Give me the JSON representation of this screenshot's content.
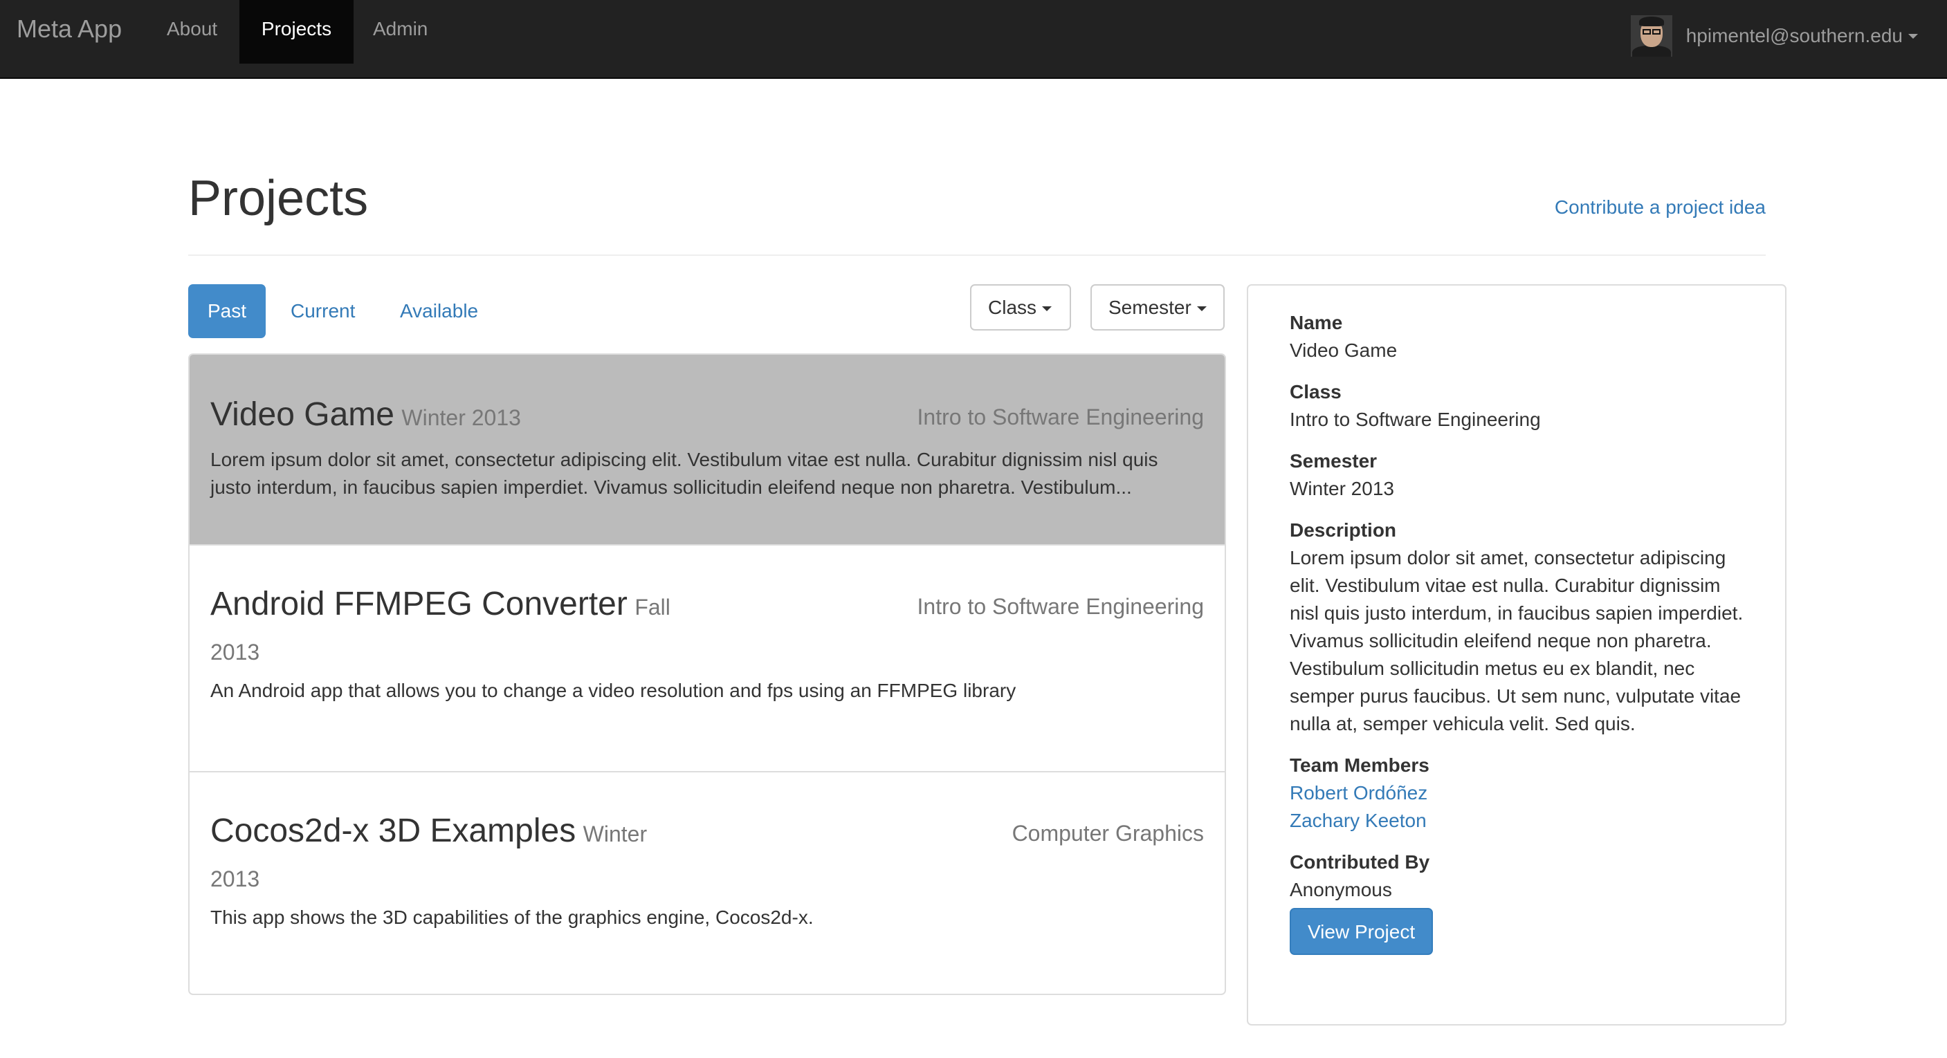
{
  "navbar": {
    "brand": "Meta App",
    "links": [
      "About",
      "Projects",
      "Admin"
    ],
    "active": "Projects",
    "user_email": "hpimentel@southern.edu"
  },
  "page": {
    "title": "Projects",
    "contribute_link": "Contribute a project idea"
  },
  "tabs": {
    "items": [
      "Past",
      "Current",
      "Available"
    ],
    "active": "Past"
  },
  "filters": {
    "class_label": "Class",
    "semester_label": "Semester"
  },
  "projects": [
    {
      "name": "Video Game",
      "semester": "Winter 2013",
      "class": "Intro to Software Engineering",
      "description": "Lorem ipsum dolor sit amet, consectetur adipiscing elit. Vestibulum vitae est nulla. Curabitur dignissim nisl quis justo interdum, in faucibus sapien imperdiet. Vivamus sollicitudin eleifend neque non pharetra. Vestibulum..."
    },
    {
      "name": "Android FFMPEG Converter",
      "semester_part1": "Fall",
      "semester_part2": "2013",
      "class": "Intro to Software Engineering",
      "description": "An Android app that allows you to change a video resolution and fps using an FFMPEG library"
    },
    {
      "name": "Cocos2d-x 3D Examples",
      "semester_part1": "Winter",
      "semester_part2": "2013",
      "class": "Computer Graphics",
      "description": "This app shows the 3D capabilities of the graphics engine, Cocos2d-x."
    }
  ],
  "detail": {
    "name_label": "Name",
    "name": "Video Game",
    "class_label": "Class",
    "class": "Intro to Software Engineering",
    "semester_label": "Semester",
    "semester": "Winter 2013",
    "description_label": "Description",
    "description": "Lorem ipsum dolor sit amet, consectetur adipiscing elit. Vestibulum vitae est nulla. Curabitur dignissim nisl quis justo interdum, in faucibus sapien imperdiet. Vivamus sollicitudin eleifend neque non pharetra. Vestibulum sollicitudin metus eu ex blandit, nec semper purus faucibus. Ut sem nunc, vulputate vitae nulla at, semper vehicula velit. Sed quis.",
    "team_label": "Team Members",
    "team": [
      "Robert Ordóñez",
      "Zachary Keeton"
    ],
    "contributed_label": "Contributed By",
    "contributed_by": "Anonymous",
    "view_button": "View Project"
  },
  "colors": {
    "navbar_bg": "#222222",
    "link": "#337ab7",
    "primary": "#428bca",
    "selected_row": "#bbbbbb"
  }
}
